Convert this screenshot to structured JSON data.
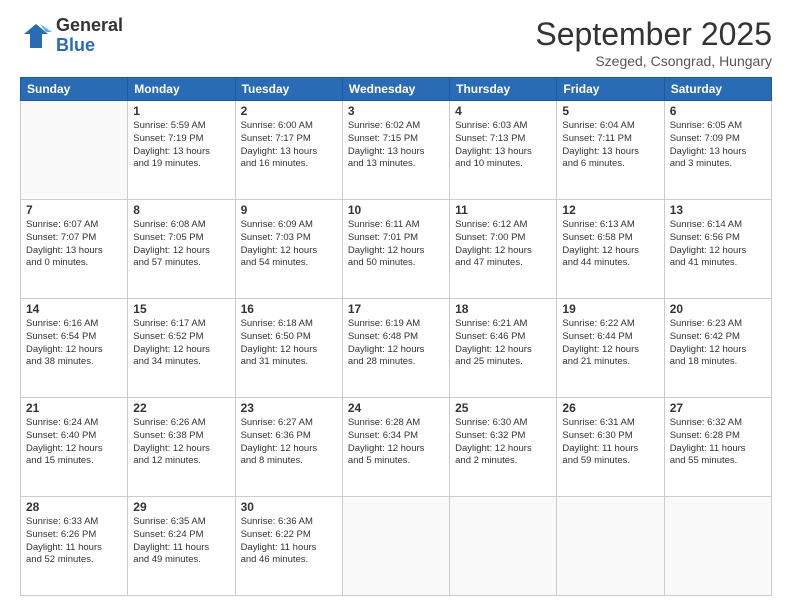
{
  "logo": {
    "general": "General",
    "blue": "Blue"
  },
  "header": {
    "month": "September 2025",
    "location": "Szeged, Csongrad, Hungary"
  },
  "days_header": [
    "Sunday",
    "Monday",
    "Tuesday",
    "Wednesday",
    "Thursday",
    "Friday",
    "Saturday"
  ],
  "weeks": [
    [
      {
        "day": "",
        "info": ""
      },
      {
        "day": "1",
        "info": "Sunrise: 5:59 AM\nSunset: 7:19 PM\nDaylight: 13 hours\nand 19 minutes."
      },
      {
        "day": "2",
        "info": "Sunrise: 6:00 AM\nSunset: 7:17 PM\nDaylight: 13 hours\nand 16 minutes."
      },
      {
        "day": "3",
        "info": "Sunrise: 6:02 AM\nSunset: 7:15 PM\nDaylight: 13 hours\nand 13 minutes."
      },
      {
        "day": "4",
        "info": "Sunrise: 6:03 AM\nSunset: 7:13 PM\nDaylight: 13 hours\nand 10 minutes."
      },
      {
        "day": "5",
        "info": "Sunrise: 6:04 AM\nSunset: 7:11 PM\nDaylight: 13 hours\nand 6 minutes."
      },
      {
        "day": "6",
        "info": "Sunrise: 6:05 AM\nSunset: 7:09 PM\nDaylight: 13 hours\nand 3 minutes."
      }
    ],
    [
      {
        "day": "7",
        "info": "Sunrise: 6:07 AM\nSunset: 7:07 PM\nDaylight: 13 hours\nand 0 minutes."
      },
      {
        "day": "8",
        "info": "Sunrise: 6:08 AM\nSunset: 7:05 PM\nDaylight: 12 hours\nand 57 minutes."
      },
      {
        "day": "9",
        "info": "Sunrise: 6:09 AM\nSunset: 7:03 PM\nDaylight: 12 hours\nand 54 minutes."
      },
      {
        "day": "10",
        "info": "Sunrise: 6:11 AM\nSunset: 7:01 PM\nDaylight: 12 hours\nand 50 minutes."
      },
      {
        "day": "11",
        "info": "Sunrise: 6:12 AM\nSunset: 7:00 PM\nDaylight: 12 hours\nand 47 minutes."
      },
      {
        "day": "12",
        "info": "Sunrise: 6:13 AM\nSunset: 6:58 PM\nDaylight: 12 hours\nand 44 minutes."
      },
      {
        "day": "13",
        "info": "Sunrise: 6:14 AM\nSunset: 6:56 PM\nDaylight: 12 hours\nand 41 minutes."
      }
    ],
    [
      {
        "day": "14",
        "info": "Sunrise: 6:16 AM\nSunset: 6:54 PM\nDaylight: 12 hours\nand 38 minutes."
      },
      {
        "day": "15",
        "info": "Sunrise: 6:17 AM\nSunset: 6:52 PM\nDaylight: 12 hours\nand 34 minutes."
      },
      {
        "day": "16",
        "info": "Sunrise: 6:18 AM\nSunset: 6:50 PM\nDaylight: 12 hours\nand 31 minutes."
      },
      {
        "day": "17",
        "info": "Sunrise: 6:19 AM\nSunset: 6:48 PM\nDaylight: 12 hours\nand 28 minutes."
      },
      {
        "day": "18",
        "info": "Sunrise: 6:21 AM\nSunset: 6:46 PM\nDaylight: 12 hours\nand 25 minutes."
      },
      {
        "day": "19",
        "info": "Sunrise: 6:22 AM\nSunset: 6:44 PM\nDaylight: 12 hours\nand 21 minutes."
      },
      {
        "day": "20",
        "info": "Sunrise: 6:23 AM\nSunset: 6:42 PM\nDaylight: 12 hours\nand 18 minutes."
      }
    ],
    [
      {
        "day": "21",
        "info": "Sunrise: 6:24 AM\nSunset: 6:40 PM\nDaylight: 12 hours\nand 15 minutes."
      },
      {
        "day": "22",
        "info": "Sunrise: 6:26 AM\nSunset: 6:38 PM\nDaylight: 12 hours\nand 12 minutes."
      },
      {
        "day": "23",
        "info": "Sunrise: 6:27 AM\nSunset: 6:36 PM\nDaylight: 12 hours\nand 8 minutes."
      },
      {
        "day": "24",
        "info": "Sunrise: 6:28 AM\nSunset: 6:34 PM\nDaylight: 12 hours\nand 5 minutes."
      },
      {
        "day": "25",
        "info": "Sunrise: 6:30 AM\nSunset: 6:32 PM\nDaylight: 12 hours\nand 2 minutes."
      },
      {
        "day": "26",
        "info": "Sunrise: 6:31 AM\nSunset: 6:30 PM\nDaylight: 11 hours\nand 59 minutes."
      },
      {
        "day": "27",
        "info": "Sunrise: 6:32 AM\nSunset: 6:28 PM\nDaylight: 11 hours\nand 55 minutes."
      }
    ],
    [
      {
        "day": "28",
        "info": "Sunrise: 6:33 AM\nSunset: 6:26 PM\nDaylight: 11 hours\nand 52 minutes."
      },
      {
        "day": "29",
        "info": "Sunrise: 6:35 AM\nSunset: 6:24 PM\nDaylight: 11 hours\nand 49 minutes."
      },
      {
        "day": "30",
        "info": "Sunrise: 6:36 AM\nSunset: 6:22 PM\nDaylight: 11 hours\nand 46 minutes."
      },
      {
        "day": "",
        "info": ""
      },
      {
        "day": "",
        "info": ""
      },
      {
        "day": "",
        "info": ""
      },
      {
        "day": "",
        "info": ""
      }
    ]
  ]
}
